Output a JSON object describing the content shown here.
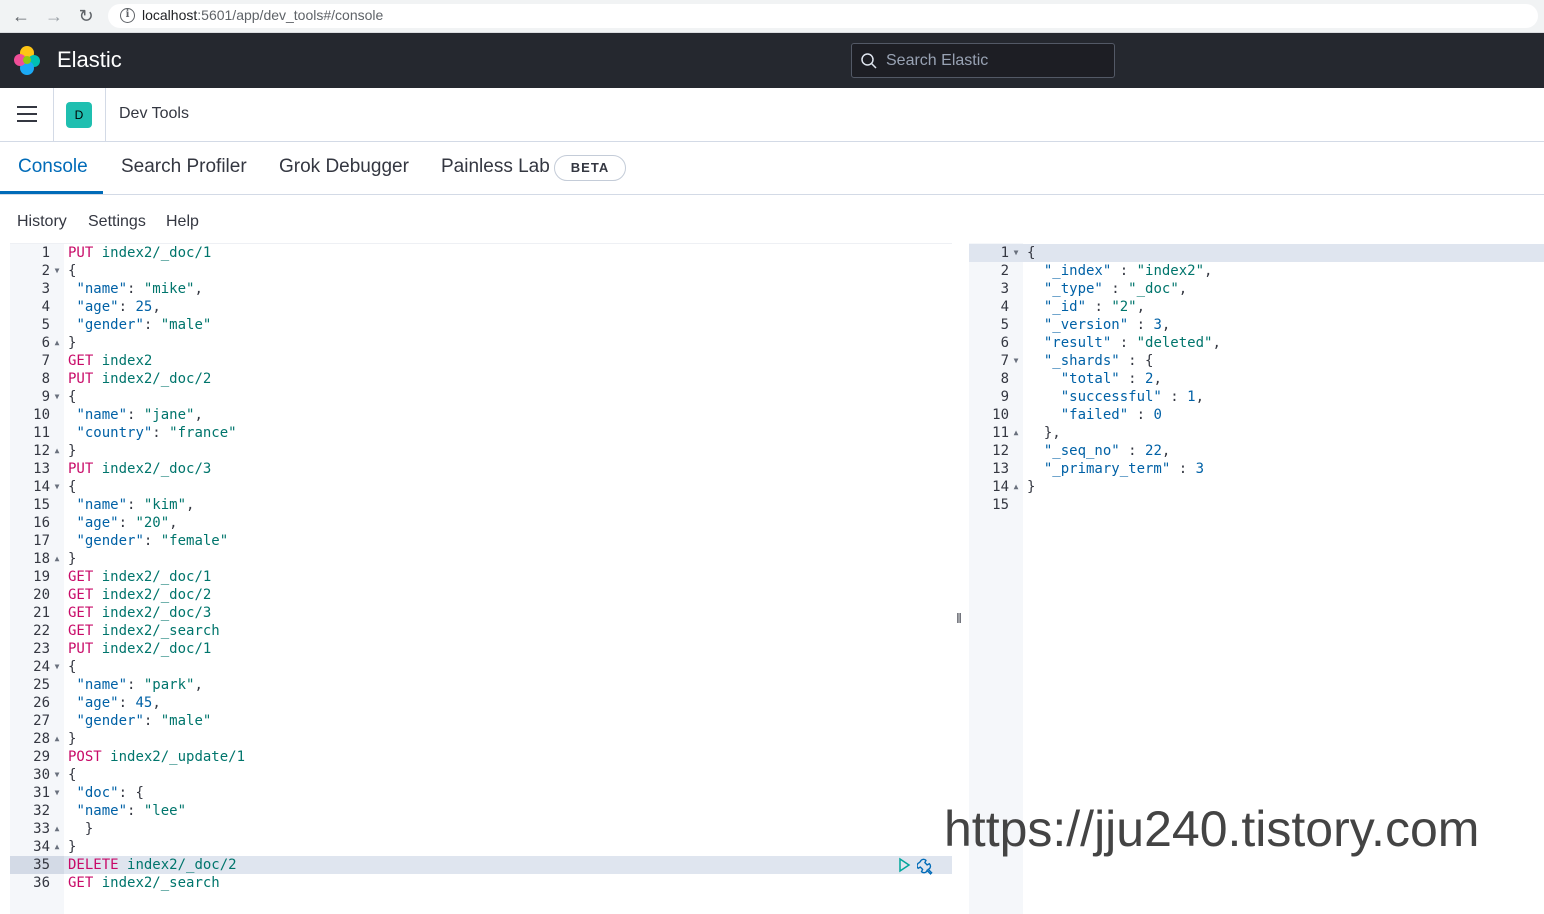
{
  "browser": {
    "url_host": "localhost",
    "url_rest": ":5601/app/dev_tools#/console"
  },
  "header": {
    "brand": "Elastic",
    "search_placeholder": "Search Elastic"
  },
  "breadcrumb": {
    "space_initial": "D",
    "title": "Dev Tools"
  },
  "tabs": [
    {
      "label": "Console",
      "active": true
    },
    {
      "label": "Search Profiler",
      "active": false
    },
    {
      "label": "Grok Debugger",
      "active": false
    },
    {
      "label": "Painless Lab",
      "active": false
    }
  ],
  "beta_badge": "BETA",
  "menu": [
    "History",
    "Settings",
    "Help"
  ],
  "input_lines": [
    {
      "n": "1",
      "fold": "",
      "tokens": [
        [
          "m",
          "PUT"
        ],
        [
          "p",
          " "
        ],
        [
          "u",
          "index2/_doc/1"
        ]
      ]
    },
    {
      "n": "2",
      "fold": "down",
      "tokens": [
        [
          "p",
          "{"
        ]
      ]
    },
    {
      "n": "3",
      "fold": "",
      "tokens": [
        [
          "p",
          " "
        ],
        [
          "k",
          "\"name\""
        ],
        [
          "p",
          ": "
        ],
        [
          "s",
          "\"mike\""
        ],
        [
          "p",
          ","
        ]
      ]
    },
    {
      "n": "4",
      "fold": "",
      "tokens": [
        [
          "p",
          " "
        ],
        [
          "k",
          "\"age\""
        ],
        [
          "p",
          ": "
        ],
        [
          "n",
          "25"
        ],
        [
          "p",
          ","
        ]
      ]
    },
    {
      "n": "5",
      "fold": "",
      "tokens": [
        [
          "p",
          " "
        ],
        [
          "k",
          "\"gender\""
        ],
        [
          "p",
          ": "
        ],
        [
          "s",
          "\"male\""
        ]
      ]
    },
    {
      "n": "6",
      "fold": "up",
      "tokens": [
        [
          "p",
          "}"
        ]
      ]
    },
    {
      "n": "7",
      "fold": "",
      "tokens": [
        [
          "m",
          "GET"
        ],
        [
          "p",
          " "
        ],
        [
          "u",
          "index2"
        ]
      ]
    },
    {
      "n": "8",
      "fold": "",
      "tokens": [
        [
          "m",
          "PUT"
        ],
        [
          "p",
          " "
        ],
        [
          "u",
          "index2/_doc/2"
        ]
      ]
    },
    {
      "n": "9",
      "fold": "down",
      "tokens": [
        [
          "p",
          "{"
        ]
      ]
    },
    {
      "n": "10",
      "fold": "",
      "tokens": [
        [
          "p",
          " "
        ],
        [
          "k",
          "\"name\""
        ],
        [
          "p",
          ": "
        ],
        [
          "s",
          "\"jane\""
        ],
        [
          "p",
          ","
        ]
      ]
    },
    {
      "n": "11",
      "fold": "",
      "tokens": [
        [
          "p",
          " "
        ],
        [
          "k",
          "\"country\""
        ],
        [
          "p",
          ": "
        ],
        [
          "s",
          "\"france\""
        ]
      ]
    },
    {
      "n": "12",
      "fold": "up",
      "tokens": [
        [
          "p",
          "}"
        ]
      ]
    },
    {
      "n": "13",
      "fold": "",
      "tokens": [
        [
          "m",
          "PUT"
        ],
        [
          "p",
          " "
        ],
        [
          "u",
          "index2/_doc/3"
        ]
      ]
    },
    {
      "n": "14",
      "fold": "down",
      "tokens": [
        [
          "p",
          "{"
        ]
      ]
    },
    {
      "n": "15",
      "fold": "",
      "tokens": [
        [
          "p",
          " "
        ],
        [
          "k",
          "\"name\""
        ],
        [
          "p",
          ": "
        ],
        [
          "s",
          "\"kim\""
        ],
        [
          "p",
          ","
        ]
      ]
    },
    {
      "n": "16",
      "fold": "",
      "tokens": [
        [
          "p",
          " "
        ],
        [
          "k",
          "\"age\""
        ],
        [
          "p",
          ": "
        ],
        [
          "s",
          "\"20\""
        ],
        [
          "p",
          ","
        ]
      ]
    },
    {
      "n": "17",
      "fold": "",
      "tokens": [
        [
          "p",
          " "
        ],
        [
          "k",
          "\"gender\""
        ],
        [
          "p",
          ": "
        ],
        [
          "s",
          "\"female\""
        ]
      ]
    },
    {
      "n": "18",
      "fold": "up",
      "tokens": [
        [
          "p",
          "}"
        ]
      ]
    },
    {
      "n": "19",
      "fold": "",
      "tokens": [
        [
          "m",
          "GET"
        ],
        [
          "p",
          " "
        ],
        [
          "u",
          "index2/_doc/1"
        ]
      ]
    },
    {
      "n": "20",
      "fold": "",
      "tokens": [
        [
          "m",
          "GET"
        ],
        [
          "p",
          " "
        ],
        [
          "u",
          "index2/_doc/2"
        ]
      ]
    },
    {
      "n": "21",
      "fold": "",
      "tokens": [
        [
          "m",
          "GET"
        ],
        [
          "p",
          " "
        ],
        [
          "u",
          "index2/_doc/3"
        ]
      ]
    },
    {
      "n": "22",
      "fold": "",
      "tokens": [
        [
          "m",
          "GET"
        ],
        [
          "p",
          " "
        ],
        [
          "u",
          "index2/_search"
        ]
      ]
    },
    {
      "n": "23",
      "fold": "",
      "tokens": [
        [
          "m",
          "PUT"
        ],
        [
          "p",
          " "
        ],
        [
          "u",
          "index2/_doc/1"
        ]
      ]
    },
    {
      "n": "24",
      "fold": "down",
      "tokens": [
        [
          "p",
          "{"
        ]
      ]
    },
    {
      "n": "25",
      "fold": "",
      "tokens": [
        [
          "p",
          " "
        ],
        [
          "k",
          "\"name\""
        ],
        [
          "p",
          ": "
        ],
        [
          "s",
          "\"park\""
        ],
        [
          "p",
          ","
        ]
      ]
    },
    {
      "n": "26",
      "fold": "",
      "tokens": [
        [
          "p",
          " "
        ],
        [
          "k",
          "\"age\""
        ],
        [
          "p",
          ": "
        ],
        [
          "n",
          "45"
        ],
        [
          "p",
          ","
        ]
      ]
    },
    {
      "n": "27",
      "fold": "",
      "tokens": [
        [
          "p",
          " "
        ],
        [
          "k",
          "\"gender\""
        ],
        [
          "p",
          ": "
        ],
        [
          "s",
          "\"male\""
        ]
      ]
    },
    {
      "n": "28",
      "fold": "up",
      "tokens": [
        [
          "p",
          "}"
        ]
      ]
    },
    {
      "n": "29",
      "fold": "",
      "tokens": [
        [
          "m",
          "POST"
        ],
        [
          "p",
          " "
        ],
        [
          "u",
          "index2/_update/1"
        ]
      ]
    },
    {
      "n": "30",
      "fold": "down",
      "tokens": [
        [
          "p",
          "{"
        ]
      ]
    },
    {
      "n": "31",
      "fold": "down",
      "tokens": [
        [
          "p",
          " "
        ],
        [
          "k",
          "\"doc\""
        ],
        [
          "p",
          ": {"
        ]
      ]
    },
    {
      "n": "32",
      "fold": "",
      "tokens": [
        [
          "p",
          " "
        ],
        [
          "k",
          "\"name\""
        ],
        [
          "p",
          ": "
        ],
        [
          "s",
          "\"lee\""
        ]
      ]
    },
    {
      "n": "33",
      "fold": "up",
      "tokens": [
        [
          "p",
          "  }"
        ]
      ]
    },
    {
      "n": "34",
      "fold": "up",
      "tokens": [
        [
          "p",
          "}"
        ]
      ]
    },
    {
      "n": "35",
      "fold": "",
      "tokens": [
        [
          "m",
          "DELETE"
        ],
        [
          "p",
          " "
        ],
        [
          "u",
          "index2/_doc/2"
        ]
      ],
      "highlight": true
    },
    {
      "n": "36",
      "fold": "",
      "tokens": [
        [
          "m",
          "GET"
        ],
        [
          "p",
          " "
        ],
        [
          "u",
          "index2/_search"
        ]
      ]
    }
  ],
  "output_lines": [
    {
      "n": "1",
      "fold": "down",
      "tokens": [
        [
          "p",
          "{"
        ]
      ],
      "highlight": true
    },
    {
      "n": "2",
      "fold": "",
      "tokens": [
        [
          "p",
          "  "
        ],
        [
          "k",
          "\"_index\""
        ],
        [
          "p",
          " : "
        ],
        [
          "s",
          "\"index2\""
        ],
        [
          "p",
          ","
        ]
      ]
    },
    {
      "n": "3",
      "fold": "",
      "tokens": [
        [
          "p",
          "  "
        ],
        [
          "k",
          "\"_type\""
        ],
        [
          "p",
          " : "
        ],
        [
          "s",
          "\"_doc\""
        ],
        [
          "p",
          ","
        ]
      ]
    },
    {
      "n": "4",
      "fold": "",
      "tokens": [
        [
          "p",
          "  "
        ],
        [
          "k",
          "\"_id\""
        ],
        [
          "p",
          " : "
        ],
        [
          "s",
          "\"2\""
        ],
        [
          "p",
          ","
        ]
      ]
    },
    {
      "n": "5",
      "fold": "",
      "tokens": [
        [
          "p",
          "  "
        ],
        [
          "k",
          "\"_version\""
        ],
        [
          "p",
          " : "
        ],
        [
          "n",
          "3"
        ],
        [
          "p",
          ","
        ]
      ]
    },
    {
      "n": "6",
      "fold": "",
      "tokens": [
        [
          "p",
          "  "
        ],
        [
          "k",
          "\"result\""
        ],
        [
          "p",
          " : "
        ],
        [
          "s",
          "\"deleted\""
        ],
        [
          "p",
          ","
        ]
      ]
    },
    {
      "n": "7",
      "fold": "down",
      "tokens": [
        [
          "p",
          "  "
        ],
        [
          "k",
          "\"_shards\""
        ],
        [
          "p",
          " : {"
        ]
      ]
    },
    {
      "n": "8",
      "fold": "",
      "tokens": [
        [
          "p",
          "    "
        ],
        [
          "k",
          "\"total\""
        ],
        [
          "p",
          " : "
        ],
        [
          "n",
          "2"
        ],
        [
          "p",
          ","
        ]
      ]
    },
    {
      "n": "9",
      "fold": "",
      "tokens": [
        [
          "p",
          "    "
        ],
        [
          "k",
          "\"successful\""
        ],
        [
          "p",
          " : "
        ],
        [
          "n",
          "1"
        ],
        [
          "p",
          ","
        ]
      ]
    },
    {
      "n": "10",
      "fold": "",
      "tokens": [
        [
          "p",
          "    "
        ],
        [
          "k",
          "\"failed\""
        ],
        [
          "p",
          " : "
        ],
        [
          "n",
          "0"
        ]
      ]
    },
    {
      "n": "11",
      "fold": "up",
      "tokens": [
        [
          "p",
          "  },"
        ]
      ]
    },
    {
      "n": "12",
      "fold": "",
      "tokens": [
        [
          "p",
          "  "
        ],
        [
          "k",
          "\"_seq_no\""
        ],
        [
          "p",
          " : "
        ],
        [
          "n",
          "22"
        ],
        [
          "p",
          ","
        ]
      ]
    },
    {
      "n": "13",
      "fold": "",
      "tokens": [
        [
          "p",
          "  "
        ],
        [
          "k",
          "\"_primary_term\""
        ],
        [
          "p",
          " : "
        ],
        [
          "n",
          "3"
        ]
      ]
    },
    {
      "n": "14",
      "fold": "up",
      "tokens": [
        [
          "p",
          "}"
        ]
      ]
    },
    {
      "n": "15",
      "fold": "",
      "tokens": []
    }
  ],
  "watermark": "https://jju240.tistory.com",
  "colors": {
    "method": "#c80a68",
    "url": "#00756c",
    "string": "#00756c",
    "number": "#0061a6",
    "key": "#0061a6",
    "accent": "#006bb8"
  }
}
